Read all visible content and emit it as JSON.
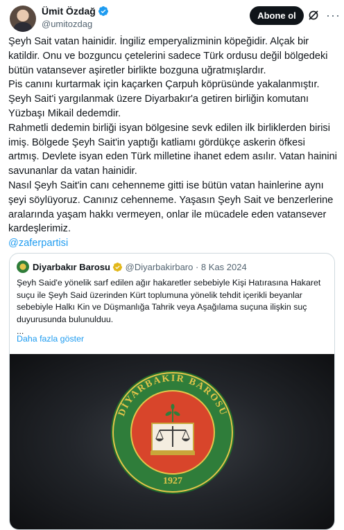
{
  "author": {
    "name": "Ümit Özdağ",
    "handle": "@umitozdag",
    "follow_label": "Abone ol",
    "more_label": "···"
  },
  "tweet": {
    "paragraphs": [
      "Şeyh Sait vatan hainidir. İngiliz emperyalizminin köpeğidir. Alçak bir katildir. Onu ve bozguncu çetelerini sadece Türk ordusu değil bölgedeki bütün vatansever aşiretler birlikte bozguna uğratmışlardır.",
      "Pis canını kurtarmak için kaçarken Çarpuh köprüsünde yakalanmıştır. Şeyh Sait'i yargılanmak üzere Diyarbakır'a getiren birliğin komutanı Yüzbaşı Mikail dedemdir.",
      "Rahmetli dedemin birliği isyan bölgesine sevk edilen ilk birliklerden birisi imiş. Bölgede Şeyh Sait'in yaptığı katliamı gördükçe askerin öfkesi artmış. Devlete isyan eden Türk milletine ihanet edem asılır. Vatan hainini savunanlar da vatan hainidir.",
      "Nasıl Şeyh Sait'in canı cehenneme gitti ise bütün vatan hainlerine aynı şeyi söylüyoruz. Canınız cehenneme. Yaşasın Şeyh Sait ve benzerlerine aralarında yaşam hakkı vermeyen, onlar ile mücadele eden vatansever kardeşlerimiz."
    ],
    "mention": "@zaferpartisi"
  },
  "quote": {
    "name": "Diyarbakır Barosu",
    "handle": "@Diyarbakirbaro",
    "date": "· 8 Kas 2024",
    "text": "Şeyh Said'e yönelik sarf edilen ağır hakaretler sebebiyle Kişi Hatırasına Hakaret suçu ile Şeyh Said üzerinden Kürt toplumuna yönelik tehdit içerikli beyanlar sebebiyle Halkı Kin ve Düşmanlığa Tahrik veya Aşağılama suçuna ilişkin suç duyurusunda bulunulduu.",
    "ellipsis": "...",
    "show_more": "Daha fazla göster",
    "logo_text": "DİYARBAKIR BAROSU",
    "logo_year": "1927"
  },
  "colors": {
    "accent": "#1d9bf0",
    "logo_green": "#2f7d3a",
    "logo_red": "#d8452b",
    "logo_gold": "#e3c54a"
  }
}
